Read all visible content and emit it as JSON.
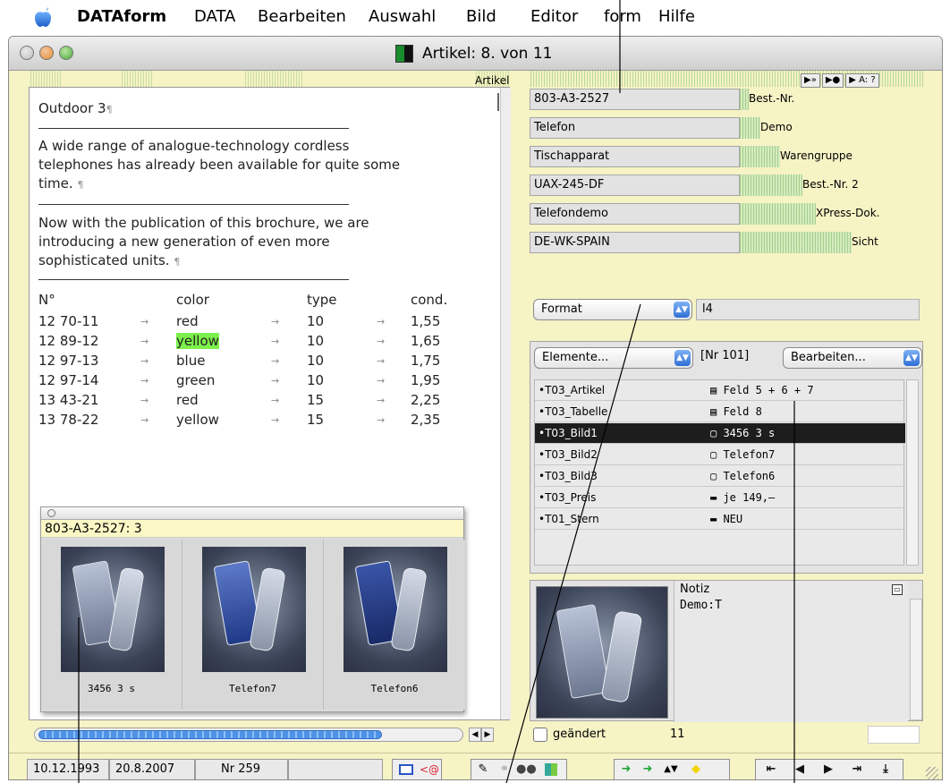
{
  "menubar": {
    "app": "DATAform",
    "items": [
      "DATA",
      "Bearbeiten",
      "Auswahl",
      "Bild",
      "Editor",
      "form",
      "Hilfe"
    ]
  },
  "window": {
    "title": "Artikel: 8. von 11",
    "artikel_label": "Artikel"
  },
  "document": {
    "heading": "Outdoor 3",
    "para1_line1": "A wide range of analogue-technology cordless",
    "para1_line2": "telephones has already been available for quite some",
    "para1_line3": "time.",
    "para2_line1": "Now with the publication of this brochure, we are",
    "para2_line2": "introducing a new generation of even more",
    "para2_line3": "sophisticated units.",
    "pilcrow": "¶",
    "table": {
      "headers": [
        "N°",
        "color",
        "type",
        "cond."
      ],
      "rows": [
        [
          "12 70-11",
          "red",
          "10",
          "1,55"
        ],
        [
          "12 89-12",
          "yellow",
          "10",
          "1,65"
        ],
        [
          "12 97-13",
          "blue",
          "10",
          "1,75"
        ],
        [
          "12 97-14",
          "green",
          "10",
          "1,95"
        ],
        [
          "13 43-21",
          "red",
          "15",
          "2,25"
        ],
        [
          "13 78-22",
          "yellow",
          "15",
          "2,35"
        ]
      ],
      "highlight_color": "#7cf04a"
    }
  },
  "picker": {
    "header": "803-A3-2527: 3",
    "images": [
      {
        "caption": "3456 3 s",
        "icon": "phone-photo"
      },
      {
        "caption": "Telefon7",
        "icon": "phone-photo-blue"
      },
      {
        "caption": "Telefon6",
        "icon": "phone-photo"
      }
    ]
  },
  "right_pane": {
    "nav_buttons": [
      "▶»",
      "▶●",
      "▶ A: ?"
    ],
    "fields": [
      {
        "value": "803-A3-2527",
        "label": "Best.-Nr."
      },
      {
        "value": "Telefon",
        "label": "Demo"
      },
      {
        "value": "Tischapparat",
        "label": "Warengruppe"
      },
      {
        "value": "UAX-245-DF",
        "label": "Best.-Nr. 2"
      },
      {
        "value": "Telefondemo",
        "label": "XPress-Dok."
      },
      {
        "value": "DE-WK-SPAIN",
        "label": "Sicht"
      }
    ],
    "format_popup": "Format",
    "format_value": "l4",
    "elements_popup": "Elemente...",
    "nr_label": "[Nr 101]",
    "bearbeiten_popup": "Bearbeiten...",
    "elements": [
      {
        "name": "•T03_Artikel",
        "value": "▤ Feld 5 + 6 + 7",
        "selected": false
      },
      {
        "name": "•T03_Tabelle",
        "value": "▤ Feld 8",
        "selected": false
      },
      {
        "name": "•T03_Bild1",
        "value": "▢ 3456 3 s",
        "selected": true
      },
      {
        "name": "•T03_Bild2",
        "value": "▢ Telefon7",
        "selected": false
      },
      {
        "name": "•T03_Bild3",
        "value": "▢ Telefon6",
        "selected": false
      },
      {
        "name": "•T03_Preis",
        "value": "▬ je 149,–",
        "selected": false
      },
      {
        "name": "•T01_Stern",
        "value": "▬ NEU",
        "selected": false
      }
    ],
    "note_title": "Notiz",
    "note_body": "Demo:T",
    "changed_label": "geändert",
    "changed_count": "11"
  },
  "statusbar": {
    "created": "10.12.1993",
    "modified": "20.8.2007",
    "record_nr": "Nr 259"
  },
  "colors": {
    "window_bg": "#f6f3c5",
    "selected_row": "#1d1d1d",
    "accent_green": "#23a63a"
  }
}
